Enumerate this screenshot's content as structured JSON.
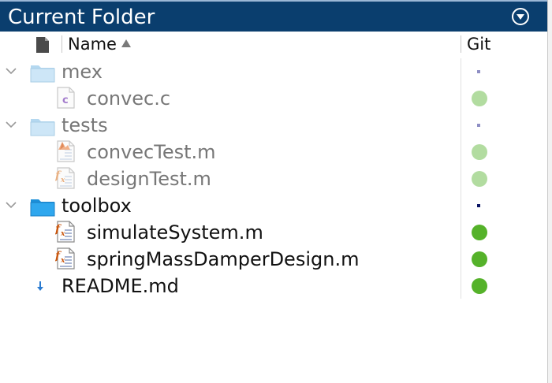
{
  "panel": {
    "title": "Current Folder"
  },
  "header": {
    "name_label": "Name",
    "git_label": "Git"
  },
  "colors": {
    "title_bar": "#0a3e6e",
    "git_modified_dot_dim": "#b2dca0",
    "git_modified_dot": "#55b22a",
    "git_folder_dot_dim": "#8e8ec4",
    "git_folder_dot": "#0b1565"
  },
  "tree": [
    {
      "name": "mex",
      "type": "folder",
      "expanded": true,
      "dimmed": true,
      "git": "folder"
    },
    {
      "name": "convec.c",
      "type": "c-file",
      "dimmed": true,
      "git": "modified"
    },
    {
      "name": "tests",
      "type": "folder",
      "expanded": true,
      "dimmed": true,
      "git": "folder"
    },
    {
      "name": "convecTest.m",
      "type": "m-test-file",
      "dimmed": true,
      "git": "modified"
    },
    {
      "name": "designTest.m",
      "type": "m-function-file",
      "dimmed": true,
      "git": "modified"
    },
    {
      "name": "toolbox",
      "type": "folder",
      "expanded": true,
      "dimmed": false,
      "git": "folder"
    },
    {
      "name": "simulateSystem.m",
      "type": "m-function-file",
      "dimmed": false,
      "git": "modified"
    },
    {
      "name": "springMassDamperDesign.m",
      "type": "m-function-file",
      "dimmed": false,
      "git": "modified"
    },
    {
      "name": "README.md",
      "type": "md-file",
      "dimmed": false,
      "git": "modified"
    }
  ]
}
